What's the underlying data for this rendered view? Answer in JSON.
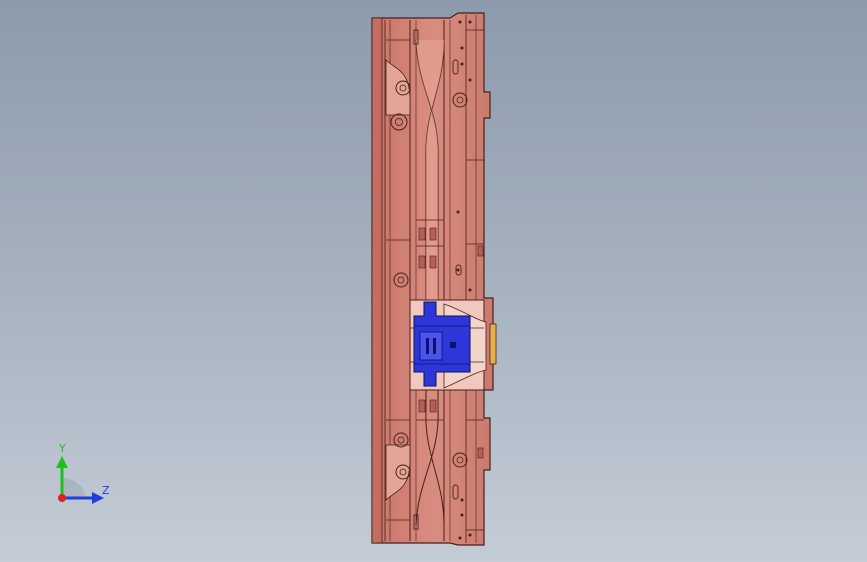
{
  "viewport": {
    "background_top": "#8c9aab",
    "background_bottom": "#c4ccd6"
  },
  "model": {
    "body_color": "#d4877a",
    "highlight_color": "#e9a898",
    "outline_color": "#4a1f1a",
    "insert_color": "#f0c8bd",
    "selected_color": "#2d36d8",
    "accent_color": "#e6b04a"
  },
  "triad": {
    "y_label": "Y",
    "z_label": "Z",
    "y_color": "#1fbf1f",
    "z_color": "#1f3fdf",
    "x_color": "#df1f1f",
    "y_icon": "arrow-up-icon",
    "z_icon": "arrow-right-icon"
  }
}
